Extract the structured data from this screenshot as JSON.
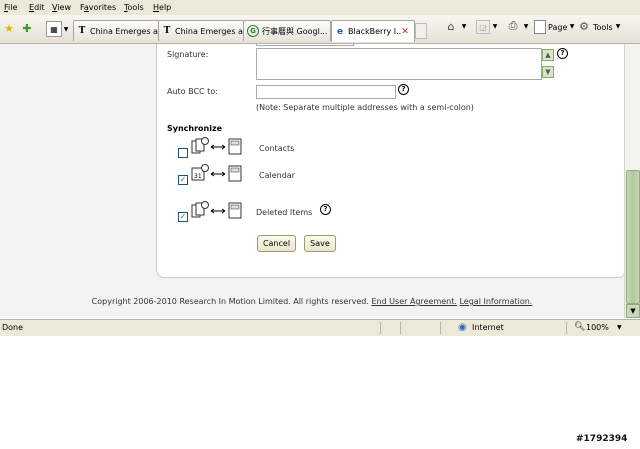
{
  "menubar": {
    "items": [
      {
        "label": "File",
        "key": "F"
      },
      {
        "label": "Edit",
        "key": "E"
      },
      {
        "label": "View",
        "key": "V"
      },
      {
        "label": "Favorites",
        "key": "a"
      },
      {
        "label": "Tools",
        "key": "T"
      },
      {
        "label": "Help",
        "key": "H"
      }
    ]
  },
  "tabs": [
    {
      "label": "China Emerges a...",
      "icon": "nyt-icon",
      "glyph": "T"
    },
    {
      "label": "China Emerges a...",
      "icon": "nyt-icon",
      "glyph": "T"
    },
    {
      "label": "行事曆與 Googl...",
      "icon": "google-calendar-icon",
      "glyph": "G"
    },
    {
      "label": "BlackBerry I...",
      "icon": "blackberry-icon",
      "glyph": "e",
      "active": true
    }
  ],
  "commandbar": {
    "page": "Page",
    "tools": "Tools"
  },
  "form": {
    "signature_label": "Signature:",
    "auto_bcc_label": "Auto BCC to:",
    "auto_bcc_value": "",
    "note": "(Note: Separate multiple addresses with a semi-colon)",
    "sync_heading": "Synchronize",
    "sync_items": [
      {
        "label": "Contacts",
        "checked": false,
        "icon": "contacts-sync-icon"
      },
      {
        "label": "Calendar",
        "checked": true,
        "icon": "calendar-sync-icon"
      },
      {
        "label": "Deleted Items",
        "checked": true,
        "icon": "deleted-items-sync-icon"
      }
    ],
    "cancel_label": "Cancel",
    "save_label": "Save"
  },
  "footer": {
    "copyright": "Copyright 2006-2010 Research In Motion Limited. All rights reserved.",
    "eua_link": "End User Agreement.",
    "legal_link": "Legal Information."
  },
  "statusbar": {
    "status": "Done",
    "zone": "Internet",
    "zoom": "100%"
  },
  "watermark": "#1792394",
  "colors": {
    "chrome": "#ece9d8",
    "page_bg": "#f3f3f3",
    "scroll_green": "#b2c69c"
  }
}
